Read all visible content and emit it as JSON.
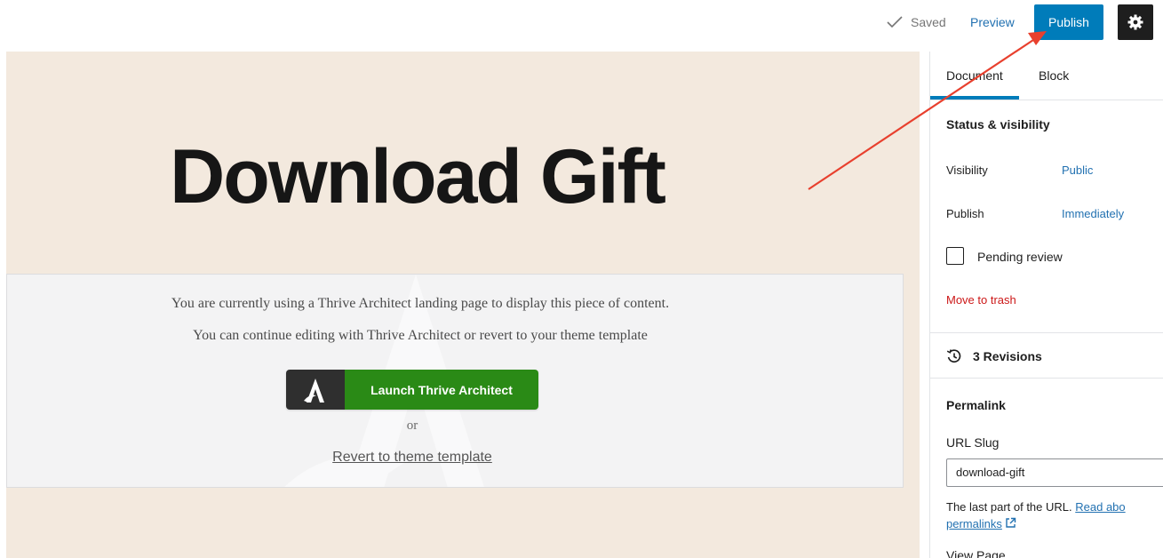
{
  "header": {
    "saved_label": "Saved",
    "preview_label": "Preview",
    "publish_label": "Publish",
    "settings_icon": "gear-icon"
  },
  "canvas": {
    "title": "Download Gift",
    "notice_line1": "You are currently using a Thrive Architect landing page to display this piece of content.",
    "notice_line2": "You can continue editing with Thrive Architect or revert to your theme template",
    "launch_label": "Launch Thrive Architect",
    "or_label": "or",
    "revert_label": "Revert to theme template"
  },
  "sidebar": {
    "tabs": [
      "Document",
      "Block"
    ],
    "status_title": "Status & visibility",
    "visibility_label": "Visibility",
    "visibility_value": "Public",
    "publish_label": "Publish",
    "publish_value": "Immediately",
    "pending_label": "Pending review",
    "trash_label": "Move to trash",
    "revisions_label": "3 Revisions",
    "permalink_title": "Permalink",
    "url_slug_label": "URL Slug",
    "url_slug_value": "download-gift",
    "help_text": "The last part of the URL.",
    "help_link_1": "Read abo",
    "help_link_2": "permalinks",
    "view_page_label": "View Page"
  },
  "colors": {
    "accent": "#007cba",
    "canvas_bg": "#f3e9de",
    "launch_green": "#2a8a16",
    "trash_red": "#cc1818",
    "arrow_red": "#e8402e"
  }
}
